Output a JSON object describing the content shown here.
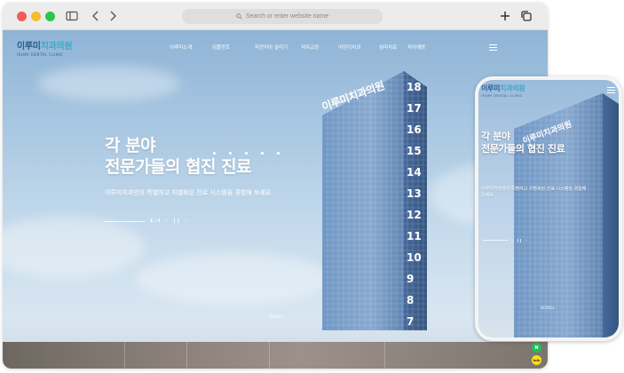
{
  "browser": {
    "address_placeholder": "Search or enter website name"
  },
  "site": {
    "logo_main": "이루미",
    "logo_accent": "치과의원",
    "logo_sub": "IRUMI DENTAL CLINIC",
    "nav": [
      "이루미소개",
      "임플란트",
      "자연치아 살리기",
      "치아교정",
      "어린이치과",
      "심미치료",
      "치아예방"
    ],
    "headline_line1": "각 분야",
    "headline_line2": "전문가들의 협진 진료",
    "subtitle": "이루미치과만의 특별하고 차별화된 진료 시스템을 경험해 보세요.",
    "pager_current": "1",
    "pager_total": "/ 4",
    "scroll_label": "SCROLL"
  },
  "floating_buttons": [
    {
      "icon": "naver-icon",
      "text": "N",
      "color": "#1fc15a"
    },
    {
      "icon": "kakao-icon",
      "text": "talk",
      "color": "#f7df1e"
    }
  ],
  "building_floor_numbers": [
    "18",
    "17",
    "16",
    "15",
    "14",
    "13",
    "12",
    "11",
    "10",
    "9",
    "8",
    "7"
  ],
  "building_sign": "이루미치과의원",
  "colors": {
    "brand": "#2a5d8f",
    "accent": "#3fa9c7"
  }
}
